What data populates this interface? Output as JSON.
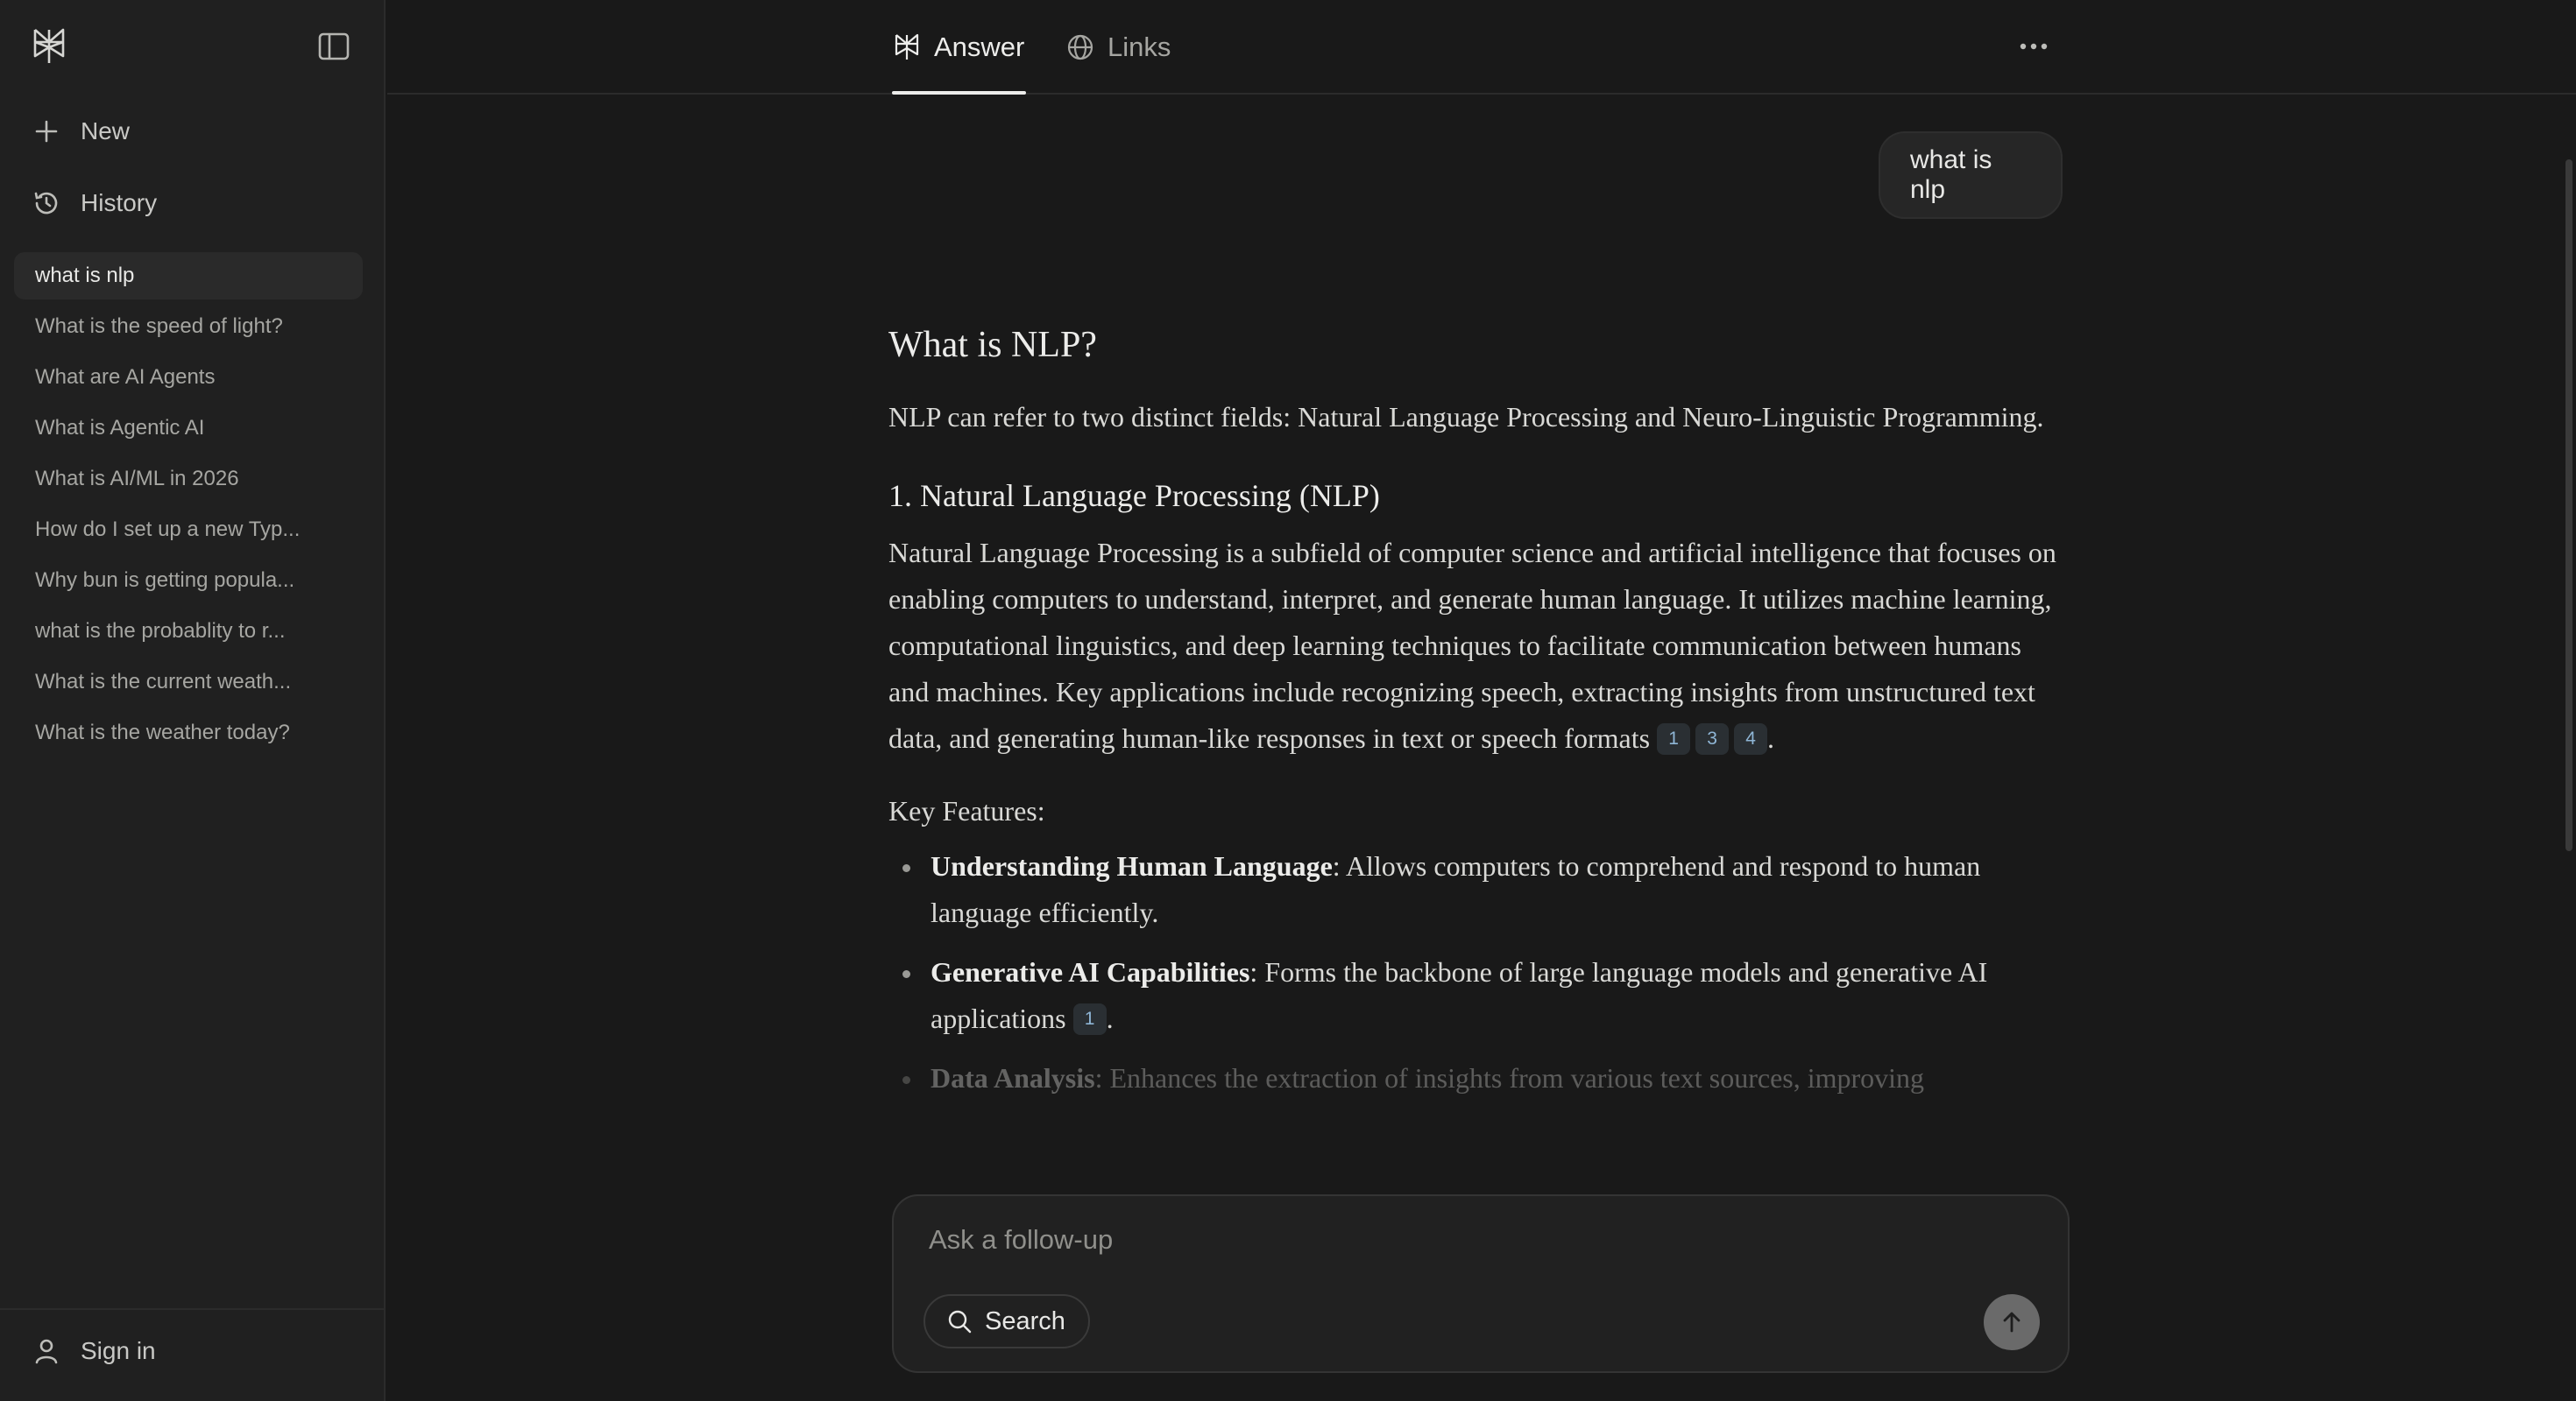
{
  "sidebar": {
    "logo_icon": "perplexity-logo-icon",
    "toggle_icon": "sidebar-toggle-icon",
    "nav": [
      {
        "label": "New",
        "icon": "plus-icon"
      },
      {
        "label": "History",
        "icon": "history-icon"
      }
    ],
    "history": [
      "what is nlp",
      "What is the speed of light?",
      "What are AI Agents",
      "What is Agentic AI",
      "What is AI/ML in 2026",
      "How do I set up a new Typ...",
      "Why bun is getting popula...",
      "what is the probablity to r...",
      "What is the current weath...",
      "What is the weather today?"
    ],
    "signin_label": "Sign in"
  },
  "header": {
    "tabs": [
      {
        "label": "Answer",
        "icon": "perplexity-icon",
        "active": true
      },
      {
        "label": "Links",
        "icon": "globe-icon",
        "active": false
      }
    ],
    "more_icon": "more-icon"
  },
  "thread": {
    "user_query": "what is nlp",
    "answer": {
      "title": "What is NLP?",
      "intro": "NLP can refer to two distinct fields: Natural Language Processing and Neuro-Linguistic Programming.",
      "section1_heading": "1. Natural Language Processing (NLP)",
      "section1_body": "Natural Language Processing is a subfield of computer science and artificial intelligence that focuses on enabling computers to understand, interpret, and generate human language. It utilizes machine learning, computational linguistics, and deep learning techniques to facilitate communication between humans and machines. Key applications include recognizing speech, extracting insights from unstructured text data, and generating human-like responses in text or speech formats",
      "section1_citations": [
        "1",
        "3",
        "4"
      ],
      "key_features_label": "Key Features:",
      "features": [
        {
          "title": "Understanding Human Language",
          "text": ": Allows computers to comprehend and respond to human language efficiently."
        },
        {
          "title": "Generative AI Capabilities",
          "text": ": Forms the backbone of large language models and generative AI applications",
          "citation": "1"
        },
        {
          "title": "Data Analysis",
          "text": ": Enhances the extraction of insights from various text sources, improving"
        }
      ]
    }
  },
  "composer": {
    "placeholder": "Ask a follow-up",
    "search_label": "Search",
    "search_icon": "search-icon",
    "send_icon": "arrow-up-icon"
  }
}
